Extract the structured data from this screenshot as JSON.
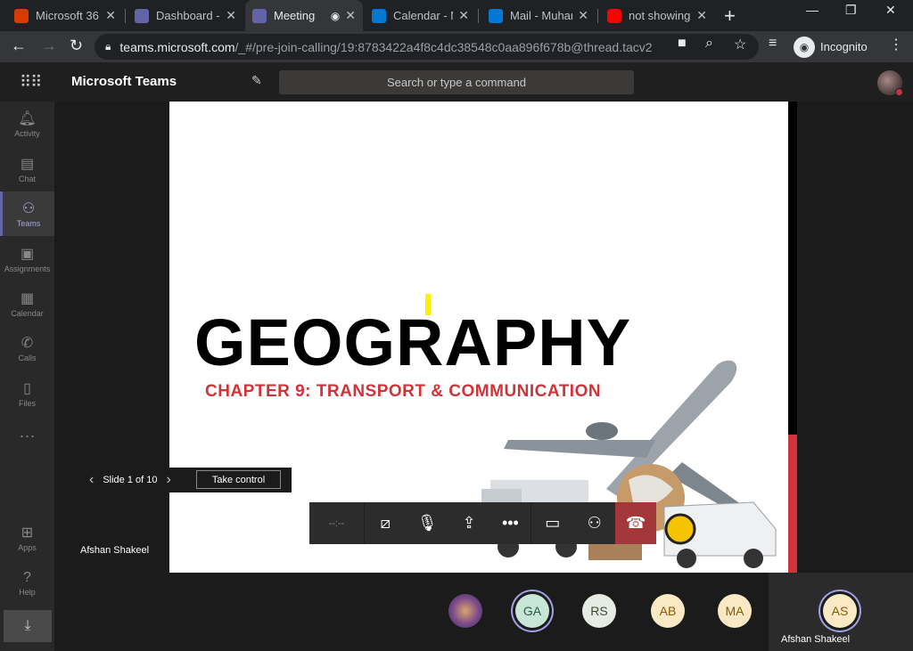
{
  "browser": {
    "tabs": [
      {
        "title": "Microsoft 36",
        "favicon": "office-icon",
        "color": "#d83b01"
      },
      {
        "title": "Dashboard -",
        "favicon": "teams-icon",
        "color": "#6264a7"
      },
      {
        "title": "Meeting",
        "favicon": "teams-icon",
        "color": "#6264a7"
      },
      {
        "title": "Calendar - M",
        "favicon": "calendar-icon",
        "color": "#0078d4"
      },
      {
        "title": "Mail - Muhar",
        "favicon": "outlook-icon",
        "color": "#0078d4"
      },
      {
        "title": "not showing",
        "favicon": "youtube-icon",
        "color": "#ff0000"
      }
    ],
    "url_host": "teams.microsoft.com",
    "url_path": "/_#/pre-join-calling/19:8783422a4f8c4dc38548c0aa896f678b@thread.tacv2",
    "incognito_label": "Incognito"
  },
  "teams": {
    "app_name": "Microsoft Teams",
    "search_placeholder": "Search or type a command",
    "rail": [
      {
        "label": "Activity",
        "icon": "bell-icon"
      },
      {
        "label": "Chat",
        "icon": "chat-icon"
      },
      {
        "label": "Teams",
        "icon": "teams-icon"
      },
      {
        "label": "Assignments",
        "icon": "assignments-icon"
      },
      {
        "label": "Calendar",
        "icon": "calendar-icon"
      },
      {
        "label": "Calls",
        "icon": "phone-icon"
      },
      {
        "label": "Files",
        "icon": "file-icon"
      }
    ],
    "rail_bottom": [
      {
        "label": "Apps",
        "icon": "apps-icon"
      },
      {
        "label": "Help",
        "icon": "help-icon"
      }
    ],
    "active_rail": "Teams"
  },
  "slide": {
    "title": "GEOGRAPHY",
    "subtitle": "CHAPTER 9: TRANSPORT & COMMUNICATION"
  },
  "slide_nav": {
    "label": "Slide 1 of 10",
    "take_control": "Take control"
  },
  "call": {
    "timer": "--:--",
    "presenter": "Afshan Shakeel",
    "hangup_color": "#a4373a"
  },
  "participants": [
    {
      "initials": "",
      "kind": "photo"
    },
    {
      "initials": "GA",
      "bg": "#c8e6d8",
      "fg": "#2b5a45"
    },
    {
      "initials": "RS",
      "bg": "#e6ece3",
      "fg": "#3d4a36"
    },
    {
      "initials": "AB",
      "bg": "#fbe9c6",
      "fg": "#8a5a00"
    },
    {
      "initials": "MA",
      "bg": "#fbe9c6",
      "fg": "#8a5a00"
    },
    {
      "initials": "AS",
      "bg": "#fbe9c6",
      "fg": "#8a5a00"
    }
  ],
  "self_tile_name": "Afshan Shakeel"
}
